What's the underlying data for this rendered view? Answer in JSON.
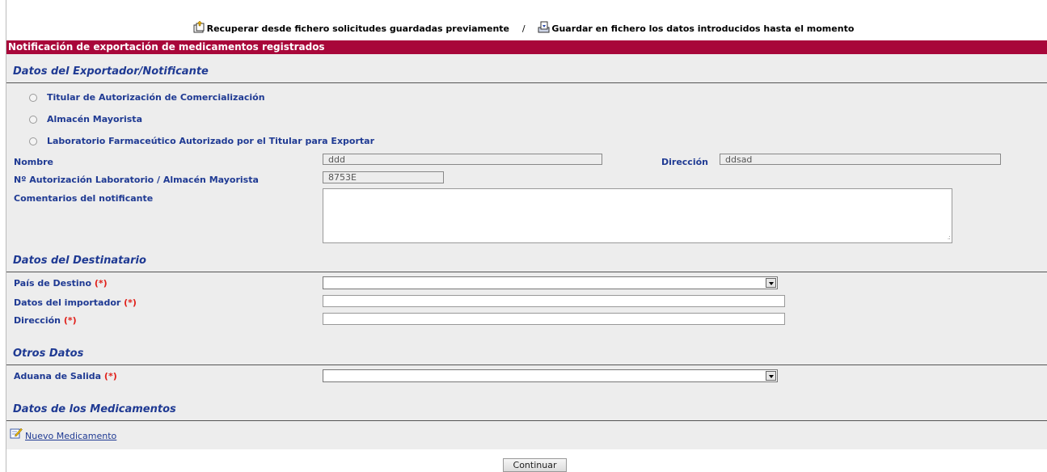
{
  "top_links": {
    "recover_label": "Recuperar desde fichero solicitudes guardadas previamente",
    "separator": "/",
    "save_label": "Guardar en fichero los datos introducidos hasta el momento"
  },
  "title": "Notificación de exportación de medicamentos registrados",
  "exporter": {
    "heading": "Datos del Exportador/Notificante",
    "options": [
      "Titular de Autorización de Comercialización",
      "Almacén Mayorista",
      "Laboratorio Farmaceútico Autorizado por el Titular para Exportar"
    ],
    "nombre_label": "Nombre",
    "nombre_value": "ddd",
    "direccion_label": "Dirección",
    "direccion_value": "ddsad",
    "autorizacion_label": "Nº Autorización Laboratorio / Almacén Mayorista",
    "autorizacion_value": "8753E",
    "comentarios_label": "Comentarios del notificante",
    "comentarios_value": ""
  },
  "destinatario": {
    "heading": "Datos del Destinatario",
    "pais_label": "País de Destino",
    "importador_label": "Datos del importador",
    "direccion_label": "Dirección",
    "required_mark": "(*)",
    "pais_value": "",
    "importador_value": "",
    "direccion_value": ""
  },
  "otros": {
    "heading": "Otros Datos",
    "aduana_label": "Aduana de Salida",
    "aduana_value": ""
  },
  "medicamentos": {
    "heading": "Datos de los Medicamentos",
    "new_link": "Nuevo Medicamento"
  },
  "continue_button": "Continuar",
  "colors": {
    "title_bar": "#a8073a",
    "panel": "#ededed",
    "label_blue": "#1f3a93",
    "required_red": "#e0201a"
  }
}
